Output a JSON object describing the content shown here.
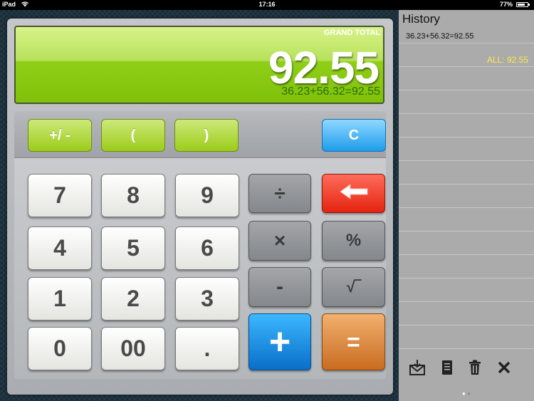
{
  "status_bar": {
    "device": "iPad",
    "time": "17:16",
    "battery": "77%",
    "battery_level": 0.77
  },
  "display": {
    "label": "GRAND TOTAL",
    "value": "92.55",
    "expression": "36.23+56.32=92.55"
  },
  "top_keys": {
    "plus_minus": "+/ -",
    "open_paren": "(",
    "close_paren": ")",
    "clear": "C"
  },
  "digits": {
    "seven": "7",
    "eight": "8",
    "nine": "9",
    "four": "4",
    "five": "5",
    "six": "6",
    "one": "1",
    "two": "2",
    "three": "3",
    "zero": "0",
    "double_zero": "00",
    "decimal": "."
  },
  "operators": {
    "divide": "÷",
    "multiply": "×",
    "percent": "%",
    "subtract": "-",
    "sqrt": "√‾",
    "add": "+",
    "equals": "="
  },
  "history": {
    "title": "History",
    "entries": [
      "36.23+56.32=92.55"
    ],
    "all_total": "ALL: 92.55"
  },
  "icons": {
    "wifi": "wifi-icon",
    "backspace": "backspace-arrow-icon",
    "email": "email-icon",
    "notes": "notes-icon",
    "trash": "trash-icon",
    "close": "close-icon"
  },
  "colors": {
    "display_green": "#9ccc1a",
    "clear_blue": "#1e9cea",
    "backspace_red": "#e42410",
    "plus_blue": "#0a6ec9",
    "equals_orange": "#c96c20",
    "history_total": "#ffe94a"
  }
}
